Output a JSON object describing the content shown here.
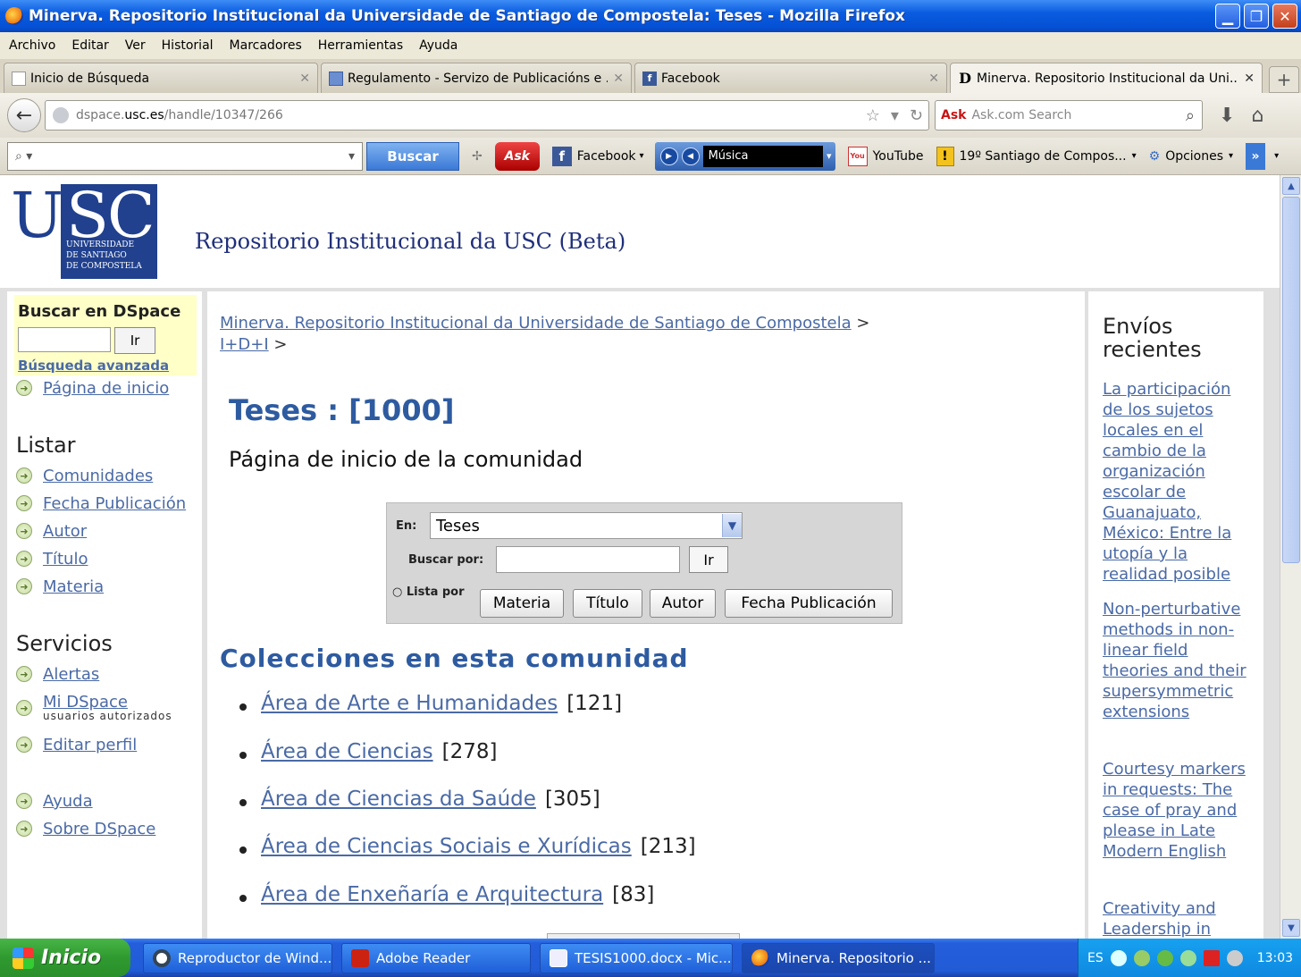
{
  "window": {
    "title": "Minerva. Repositorio Institucional da Universidade de Santiago de Compostela: Teses - Mozilla Firefox"
  },
  "menu": [
    "Archivo",
    "Editar",
    "Ver",
    "Historial",
    "Marcadores",
    "Herramientas",
    "Ayuda"
  ],
  "tabs": [
    {
      "label": "Inicio de Búsqueda",
      "icon": "blank-page-icon"
    },
    {
      "label": "Regulamento - Servizo de Publicacións e ...",
      "icon": "page-icon"
    },
    {
      "label": "Facebook",
      "icon": "facebook-icon"
    },
    {
      "label": "Minerva. Repositorio Institucional da Uni...",
      "icon": "dspace-icon"
    }
  ],
  "address": {
    "host_prefix": "dspace.",
    "host_main": "usc.es",
    "path": "/handle/10347/266"
  },
  "search_engine": {
    "brand": "Ask",
    "placeholder": "Ask.com Search"
  },
  "toolbar": {
    "buscar": "Buscar",
    "ask": "Ask",
    "facebook": "Facebook",
    "music": "Música",
    "youtube": "YouTube",
    "weather": "19º Santiago de Compos...",
    "options": "Opciones"
  },
  "site": {
    "logo_letters": [
      "U",
      "SC"
    ],
    "logo_sub": [
      "UNIVERSIDADE",
      "DE SANTIAGO",
      "DE COMPOSTELA"
    ],
    "name": "Repositorio Institucional da USC (Beta)"
  },
  "sidebar": {
    "search_title": "Buscar en DSpace",
    "go": "Ir",
    "advanced": "Búsqueda avanzada",
    "home": "Página de inicio",
    "browse_title": "Listar",
    "browse": [
      "Comunidades",
      "Fecha Publicación",
      "Autor",
      "Título",
      "Materia"
    ],
    "services_title": "Servicios",
    "alerts": "Alertas",
    "mydspace": "Mi DSpace",
    "mydspace_note": "usuarios autorizados",
    "edit_profile": "Editar perfil",
    "help": "Ayuda",
    "about": "Sobre DSpace"
  },
  "breadcrumb": {
    "root": "Minerva. Repositorio Institucional da Universidade de Santiago de Compostela",
    "sep": ">",
    "second": "I+D+I"
  },
  "community": {
    "title": "Teses : [1000]",
    "subtitle": "Página de inicio de la comunidad"
  },
  "search_form": {
    "in_label": "En:",
    "in_value": "Teses",
    "query_label": "Buscar por:",
    "go": "Ir",
    "browse_label": "Lista por",
    "browse_buttons": [
      "Materia",
      "Título",
      "Autor",
      "Fecha Publicación"
    ]
  },
  "collections": {
    "title": "Colecciones en esta comunidad",
    "items": [
      {
        "name": "Área de Arte e Humanidades",
        "count": "[121]"
      },
      {
        "name": "Área de Ciencias",
        "count": "[278]"
      },
      {
        "name": "Área de Ciencias da Saúde",
        "count": "[305]"
      },
      {
        "name": "Área de Ciencias Sociais e Xurídicas",
        "count": "[213]"
      },
      {
        "name": "Área de Enxeñaría e Arquitectura",
        "count": "[83]"
      }
    ]
  },
  "recent": {
    "title": "Envíos recientes",
    "items": [
      "La participación de los sujetos locales en el cambio de la organización escolar de Guanajuato, México: Entre la utopía y la realidad posible",
      "Non-perturbative methods in non-linear field theories and their supersymmetric extensions",
      "Courtesy markers in requests: The case of pray and please in Late Modern English",
      "Creativity and Leadership in"
    ]
  },
  "taskbar": {
    "start": "Inicio",
    "items": [
      "Reproductor de Wind...",
      "Adobe Reader",
      "TESIS1000.docx - Mic...",
      "Minerva. Repositorio ..."
    ],
    "lang": "ES",
    "clock": "13:03"
  }
}
